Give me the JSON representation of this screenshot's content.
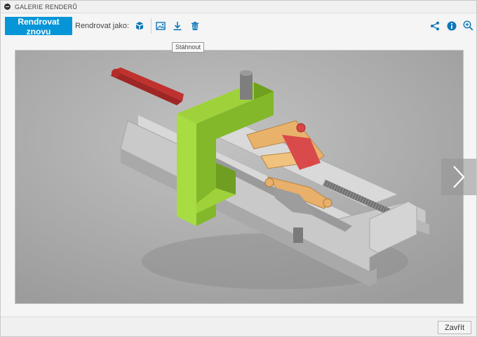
{
  "window": {
    "title": "GALERIE RENDERŮ"
  },
  "toolbar": {
    "rerender_label": "Rendrovat znovu",
    "render_as_label": "Rendrovat jako:",
    "download_tooltip": "Stáhnout",
    "accent_color": "#0696d7",
    "icons": [
      "render-as-cube-icon",
      "edit-image-icon",
      "download-icon",
      "delete-icon",
      "share-icon",
      "info-icon",
      "zoom-in-icon"
    ]
  },
  "viewer": {
    "next_icon": "chevron-right-icon"
  },
  "footer": {
    "close_label": "Zavřít"
  }
}
